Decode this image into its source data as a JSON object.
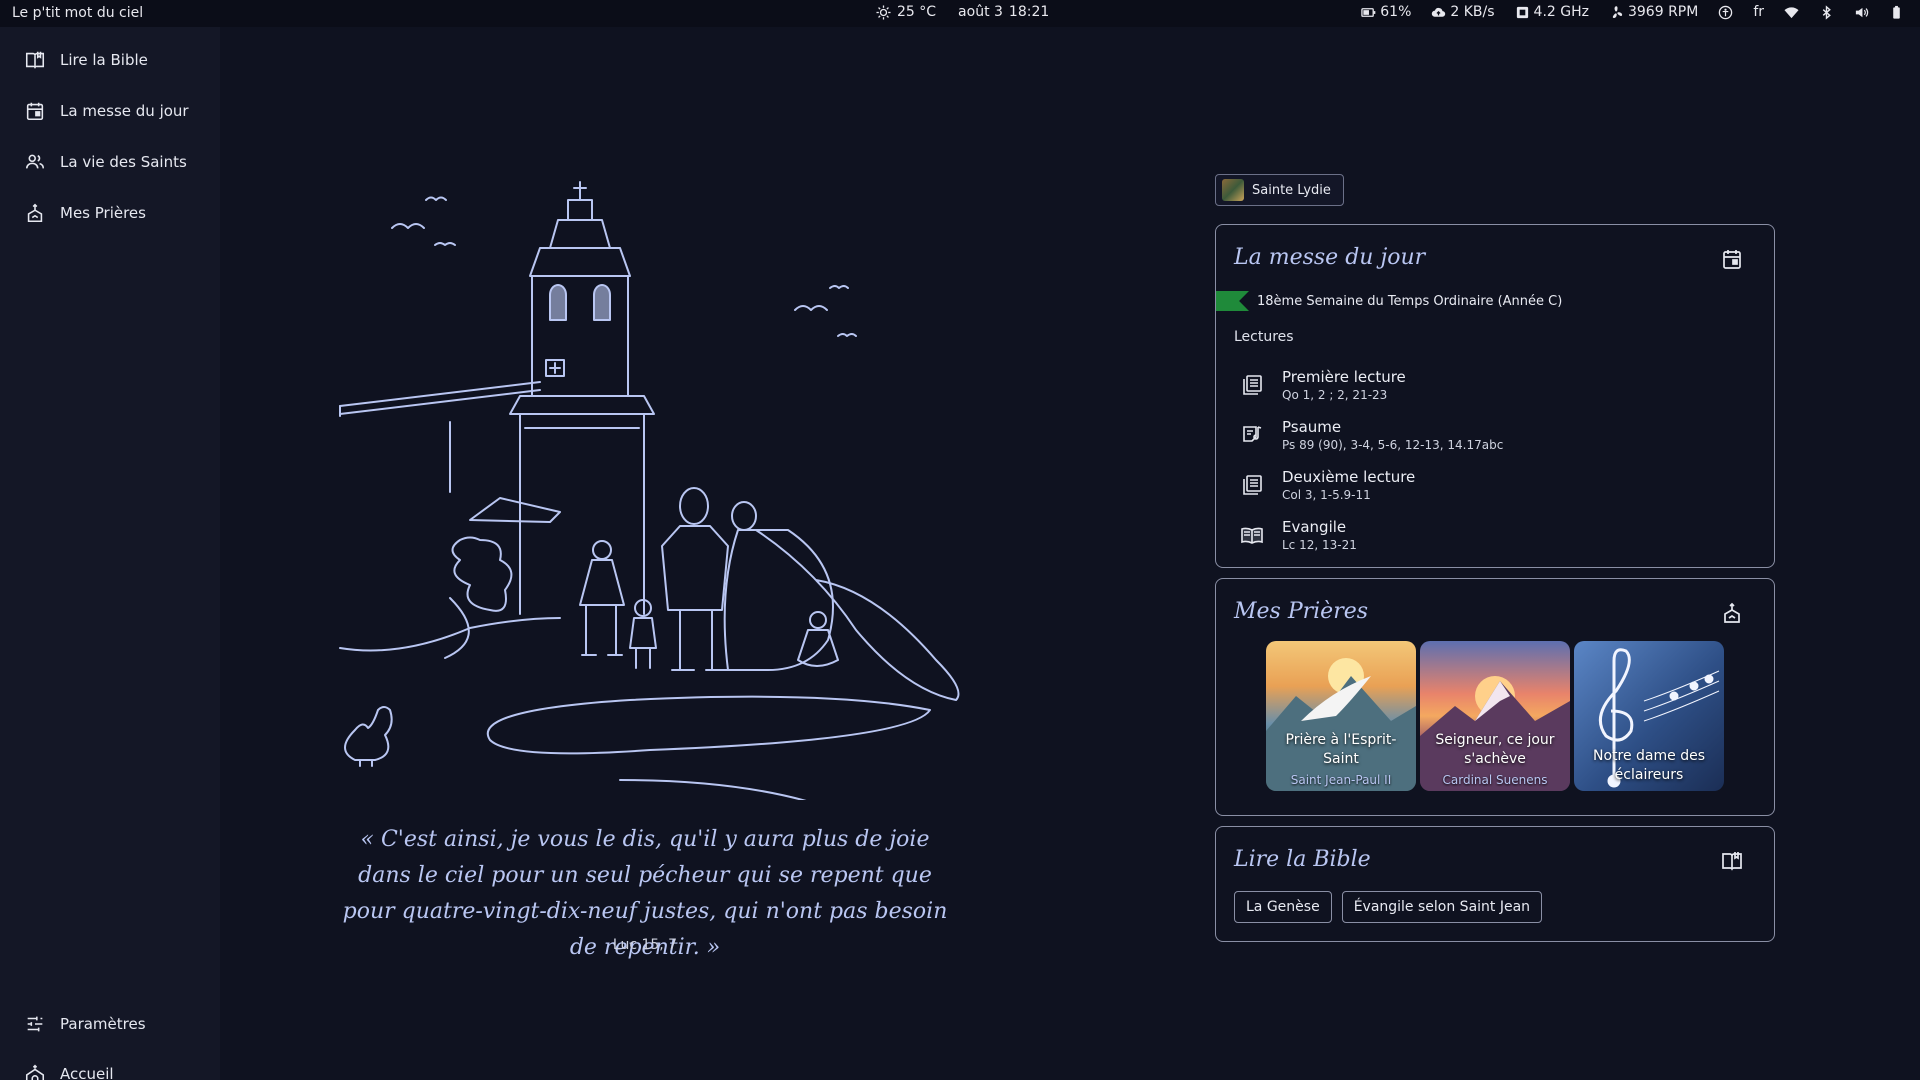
{
  "topbar": {
    "app_title": "Le p'tit mot du ciel",
    "weather": "25 °C",
    "date": "août 3",
    "time": "18:21",
    "battery_percent": "61%",
    "network_speed": "2 KB/s",
    "cpu_freq": "4.2 GHz",
    "fan_rpm": "3969 RPM",
    "language": "fr"
  },
  "sidebar": {
    "items": [
      {
        "label": "Lire la Bible",
        "icon": "book-open-icon"
      },
      {
        "label": "La messe du jour",
        "icon": "calendar-icon"
      },
      {
        "label": "La vie des Saints",
        "icon": "people-icon"
      },
      {
        "label": "Mes Prières",
        "icon": "praying-hands-icon"
      }
    ],
    "bottom_items": [
      {
        "label": "Paramètres",
        "icon": "sliders-icon"
      },
      {
        "label": "Accueil",
        "icon": "church-home-icon"
      }
    ]
  },
  "quote": {
    "text": "« C'est ainsi, je vous le dis, qu'il y aura plus de joie dans le ciel pour un seul pécheur qui se repent que pour quatre-vingt-dix-neuf justes, qui n'ont pas besoin de repentir. »",
    "reference": "Luc 15, 7"
  },
  "saint": {
    "name": "Sainte Lydie"
  },
  "mass": {
    "title": "La messe du jour",
    "week": "18ème Semaine du Temps Ordinaire (Année C)",
    "liturgical_color": "#1f8a3a",
    "lectures_label": "Lectures",
    "readings": [
      {
        "title": "Première lecture",
        "ref": "Qo 1, 2 ; 2, 21-23"
      },
      {
        "title": "Psaume",
        "ref": "Ps 89 (90), 3-4, 5-6, 12-13, 14.17abc"
      },
      {
        "title": "Deuxième lecture",
        "ref": "Col 3, 1-5.9-11"
      },
      {
        "title": "Evangile",
        "ref": "Lc 12, 13-21"
      }
    ]
  },
  "prayers": {
    "title": "Mes Prières",
    "items": [
      {
        "title": "Prière à l'Esprit-Saint",
        "author": "Saint Jean-Paul II"
      },
      {
        "title": "Seigneur, ce jour s'achève",
        "author": "Cardinal Suenens"
      },
      {
        "title": "Notre dame des éclaireurs",
        "author": ""
      }
    ]
  },
  "bible": {
    "title": "Lire la Bible",
    "books": [
      "La Genèse",
      "Évangile selon Saint Jean"
    ]
  },
  "colors": {
    "accent": "#b9c6f2",
    "background": "#0f1220",
    "sidebar": "#141726"
  }
}
